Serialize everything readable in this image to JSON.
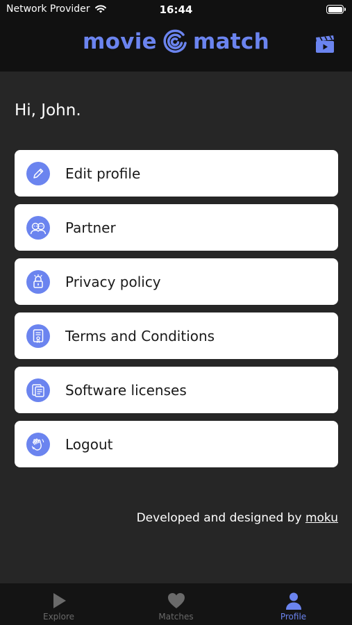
{
  "status_bar": {
    "carrier": "Network Provider",
    "time": "16:44"
  },
  "header": {
    "logo_left": "movie",
    "logo_right": "match"
  },
  "greeting": "Hi, John.",
  "menu": [
    {
      "label": "Edit profile",
      "icon": "pencil-icon"
    },
    {
      "label": "Partner",
      "icon": "partner-faces-icon"
    },
    {
      "label": "Privacy policy",
      "icon": "lock-icon"
    },
    {
      "label": "Terms and Conditions",
      "icon": "certificate-document-icon"
    },
    {
      "label": "Software licenses",
      "icon": "documents-icon"
    },
    {
      "label": "Logout",
      "icon": "waving-hand-icon"
    }
  ],
  "footer": {
    "credit_text": "Developed and designed by",
    "credit_link": "moku"
  },
  "tabs": [
    {
      "label": "Explore",
      "icon": "play-icon",
      "active": false
    },
    {
      "label": "Matches",
      "icon": "heart-icon",
      "active": false
    },
    {
      "label": "Profile",
      "icon": "person-icon",
      "active": true
    }
  ],
  "colors": {
    "accent": "#6b84ef",
    "background": "#262626",
    "header": "#111111",
    "card": "#ffffff",
    "tab_inactive": "#6a6a6a"
  }
}
